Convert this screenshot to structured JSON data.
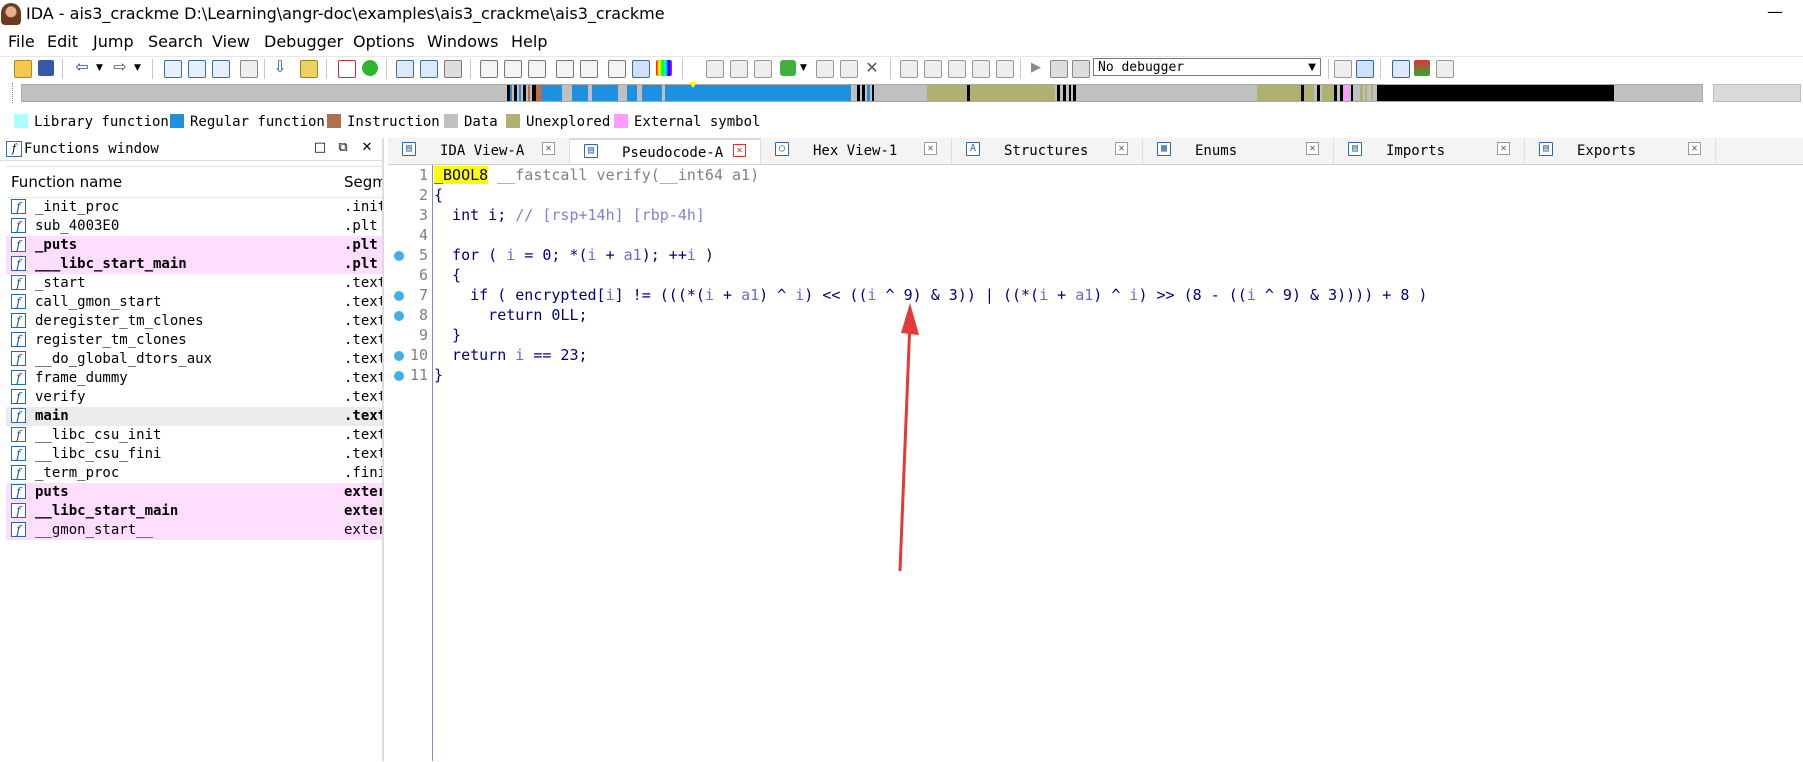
{
  "window": {
    "title": "IDA - ais3_crackme D:\\Learning\\angr-doc\\examples\\ais3_crackme\\ais3_crackme",
    "minimize": "—"
  },
  "menu": [
    {
      "label": "File"
    },
    {
      "label": "Edit"
    },
    {
      "label": "Jump"
    },
    {
      "label": "Search"
    },
    {
      "label": "View"
    },
    {
      "label": "Debugger"
    },
    {
      "label": "Options"
    },
    {
      "label": "Windows"
    },
    {
      "label": "Help"
    }
  ],
  "toolbar": {
    "debugger_select": "No debugger"
  },
  "legend": [
    {
      "label": "Library function",
      "color": "#aaffff"
    },
    {
      "label": "Regular function",
      "color": "#1e90e0"
    },
    {
      "label": "Instruction",
      "color": "#b07050"
    },
    {
      "label": "Data",
      "color": "#c0c0c0"
    },
    {
      "label": "Unexplored",
      "color": "#b0b070"
    },
    {
      "label": "External symbol",
      "color": "#ff9cff"
    }
  ],
  "functions_window": {
    "title": "Functions window",
    "col_name": "Function name",
    "col_segment": "Segm",
    "rows": [
      {
        "name": "_init_proc",
        "segment": ".init",
        "style": "normal"
      },
      {
        "name": "sub_4003E0",
        "segment": ".plt",
        "style": "normal"
      },
      {
        "name": "_puts",
        "segment": ".plt",
        "style": "ext"
      },
      {
        "name": "___libc_start_main",
        "segment": ".plt",
        "style": "ext"
      },
      {
        "name": "_start",
        "segment": ".text",
        "style": "normal"
      },
      {
        "name": "call_gmon_start",
        "segment": ".text",
        "style": "normal"
      },
      {
        "name": "deregister_tm_clones",
        "segment": ".text",
        "style": "normal"
      },
      {
        "name": "register_tm_clones",
        "segment": ".text",
        "style": "normal"
      },
      {
        "name": "__do_global_dtors_aux",
        "segment": ".text",
        "style": "normal"
      },
      {
        "name": "frame_dummy",
        "segment": ".text",
        "style": "normal"
      },
      {
        "name": "verify",
        "segment": ".text",
        "style": "normal"
      },
      {
        "name": "main",
        "segment": ".text",
        "style": "sel"
      },
      {
        "name": "__libc_csu_init",
        "segment": ".text",
        "style": "normal"
      },
      {
        "name": "__libc_csu_fini",
        "segment": ".text",
        "style": "normal"
      },
      {
        "name": "_term_proc",
        "segment": ".fini",
        "style": "normal"
      },
      {
        "name": "puts",
        "segment": "extern",
        "style": "ext"
      },
      {
        "name": "__libc_start_main",
        "segment": "extern",
        "style": "ext"
      },
      {
        "name": "__gmon_start__",
        "segment": "extern",
        "style": "extlight"
      }
    ]
  },
  "tabs": [
    {
      "label": "IDA View-A",
      "icon": "ida-view-icon"
    },
    {
      "label": "Pseudocode-A",
      "icon": "pseudocode-icon",
      "active": true
    },
    {
      "label": "Hex View-1",
      "icon": "hex-view-icon"
    },
    {
      "label": "Structures",
      "icon": "structures-icon"
    },
    {
      "label": "Enums",
      "icon": "enums-icon"
    },
    {
      "label": "Imports",
      "icon": "imports-icon"
    },
    {
      "label": "Exports",
      "icon": "exports-icon"
    }
  ],
  "code": {
    "lines": [
      {
        "n": "1",
        "dot": false
      },
      {
        "n": "2",
        "dot": false
      },
      {
        "n": "3",
        "dot": false
      },
      {
        "n": "4",
        "dot": false
      },
      {
        "n": "5",
        "dot": true
      },
      {
        "n": "6",
        "dot": false
      },
      {
        "n": "7",
        "dot": true
      },
      {
        "n": "8",
        "dot": true
      },
      {
        "n": "9",
        "dot": false
      },
      {
        "n": "10",
        "dot": true
      },
      {
        "n": "11",
        "dot": true
      }
    ]
  }
}
